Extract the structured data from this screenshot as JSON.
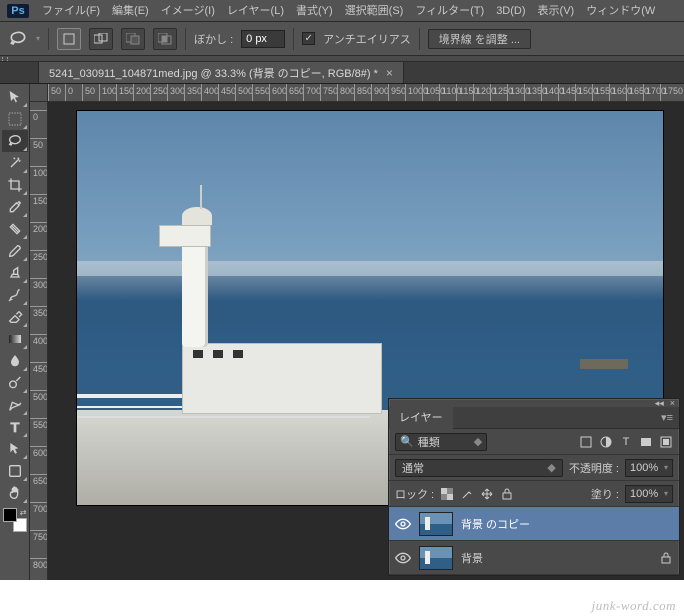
{
  "menu": {
    "items": [
      "ファイル(F)",
      "編集(E)",
      "イメージ(I)",
      "レイヤー(L)",
      "書式(Y)",
      "選択範囲(S)",
      "フィルター(T)",
      "3D(D)",
      "表示(V)",
      "ウィンドウ(W"
    ]
  },
  "optionbar": {
    "feather_label": "ぼかし :",
    "feather_value": "0 px",
    "antialias_label": "アンチエイリアス",
    "antialias_checked": true,
    "refine_label": "境界線 を調整 ..."
  },
  "tab": {
    "title": "5241_030911_104871med.jpg @ 33.3% (背景 のコピー, RGB/8#) *"
  },
  "ruler_h": [
    "50",
    "0",
    "50",
    "100",
    "150",
    "200",
    "250",
    "300",
    "350",
    "400",
    "450",
    "500",
    "550",
    "600",
    "650",
    "700",
    "750",
    "800",
    "850",
    "900",
    "950",
    "1000",
    "1050",
    "1100",
    "1150",
    "1200",
    "1250",
    "1300",
    "1350",
    "1400",
    "1450",
    "1500",
    "1550",
    "1600",
    "1650",
    "1700",
    "1750"
  ],
  "ruler_v": [
    "0",
    "50",
    "100",
    "150",
    "200",
    "250",
    "300",
    "350",
    "400",
    "450",
    "500",
    "550",
    "600",
    "650",
    "700",
    "750",
    "800"
  ],
  "panel": {
    "tab": "レイヤー",
    "filter_kind": "種類",
    "blend_mode": "通常",
    "opacity_label": "不透明度 :",
    "opacity_value": "100%",
    "lock_label": "ロック :",
    "fill_label": "塗り :",
    "fill_value": "100%",
    "layers": [
      {
        "name": "背景 のコピー",
        "selected": true,
        "locked": false
      },
      {
        "name": "背景",
        "selected": false,
        "locked": true
      }
    ]
  },
  "watermark": "junk-word.com"
}
